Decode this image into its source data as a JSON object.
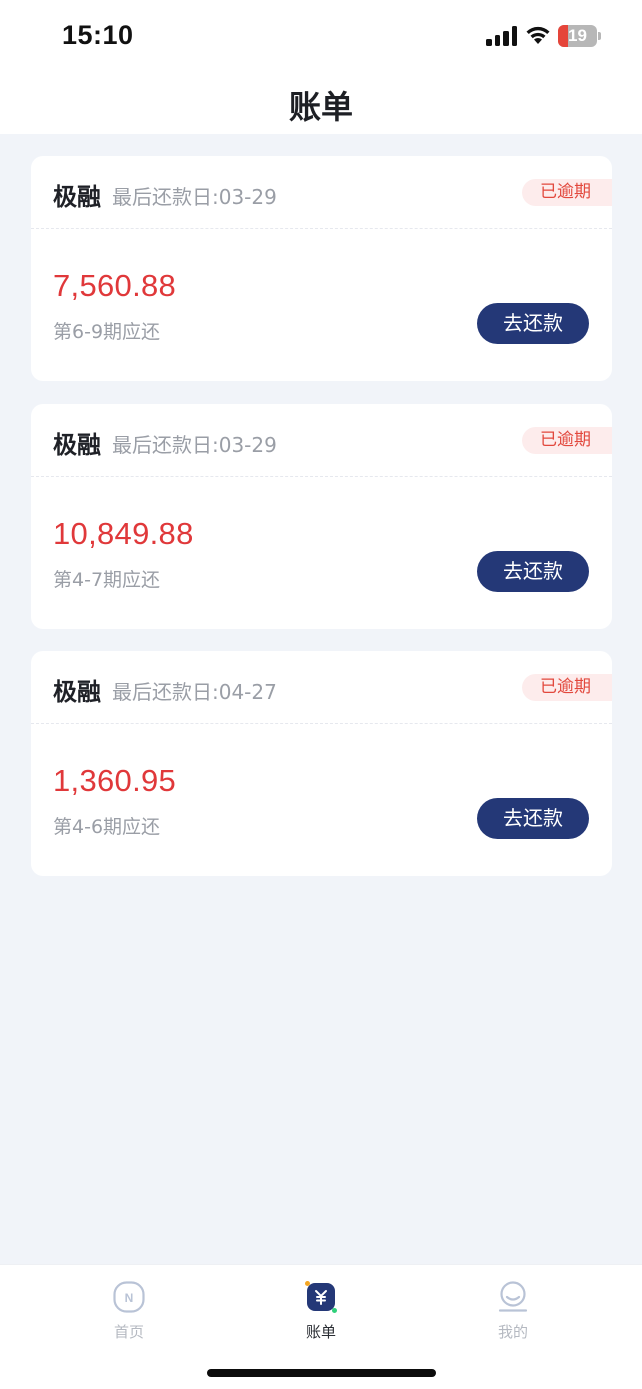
{
  "status_bar": {
    "time": "15:10",
    "battery_level": "19",
    "battery_fraction": 0.19,
    "battery_color": "#e5453a"
  },
  "header": {
    "title": "账单"
  },
  "bills": [
    {
      "lender": "极融",
      "due_date": "最后还款日:03-29",
      "status": "已逾期",
      "amount": "7,560.88",
      "period": "第6-9期应还",
      "action": "去还款"
    },
    {
      "lender": "极融",
      "due_date": "最后还款日:03-29",
      "status": "已逾期",
      "amount": "10,849.88",
      "period": "第4-7期应还",
      "action": "去还款"
    },
    {
      "lender": "极融",
      "due_date": "最后还款日:04-27",
      "status": "已逾期",
      "amount": "1,360.95",
      "period": "第4-6期应还",
      "action": "去还款"
    }
  ],
  "tab_bar": {
    "tabs": [
      {
        "label": "首页",
        "icon": "home-icon",
        "active": false
      },
      {
        "label": "账单",
        "icon": "bill-icon",
        "active": true
      },
      {
        "label": "我的",
        "icon": "profile-icon",
        "active": false
      }
    ]
  },
  "colors": {
    "accent": "#243877",
    "amount": "#e0383a",
    "overdue_badge_text": "#e2483d",
    "overdue_badge_bg": "#fdecec",
    "background": "#f1f4f9"
  }
}
